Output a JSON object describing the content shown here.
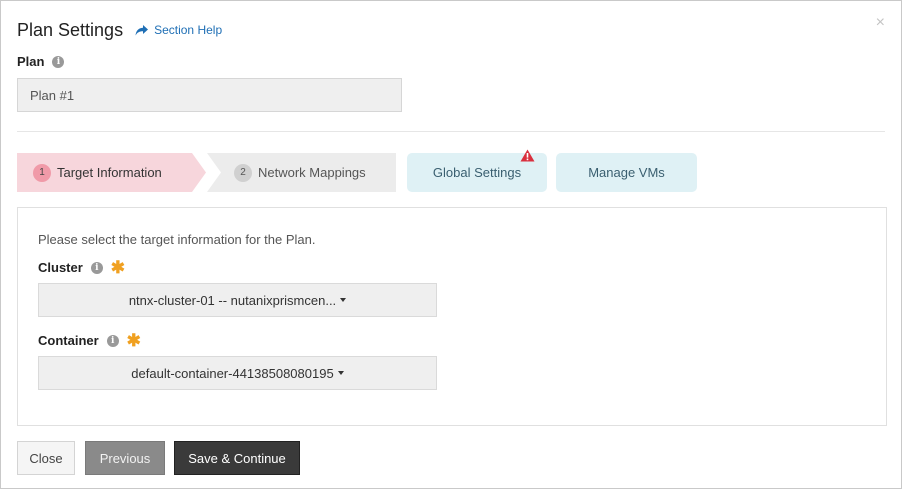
{
  "dialog": {
    "title": "Plan Settings",
    "help_link": "Section Help",
    "close_glyph": "×"
  },
  "plan": {
    "label": "Plan",
    "value": "Plan #1"
  },
  "steps": [
    {
      "number": "1",
      "label": "Target Information",
      "state": "active"
    },
    {
      "number": "2",
      "label": "Network Mappings",
      "state": "inactive"
    }
  ],
  "tabs": [
    {
      "label": "Global Settings",
      "warning": true
    },
    {
      "label": "Manage VMs",
      "warning": false
    }
  ],
  "panel": {
    "description": "Please select the target information for the Plan.",
    "cluster": {
      "label": "Cluster",
      "required": true,
      "selected": "ntnx-cluster-01 -- nutanixprismcen..."
    },
    "container": {
      "label": "Container",
      "required": true,
      "selected": "default-container-44138508080195"
    }
  },
  "buttons": {
    "close": "Close",
    "previous": "Previous",
    "save": "Save & Continue"
  },
  "icons": {
    "info": "info-icon",
    "required": "asterisk-icon",
    "warning": "warning-triangle-icon",
    "help": "share-arrow-icon"
  },
  "colors": {
    "active_step": "#f7d6dc",
    "inactive_step": "#ececec",
    "tab_bg": "#dff1f5",
    "warning": "#d9303e",
    "required": "#f0a020",
    "link": "#1f6fb5",
    "primary_button": "#3a3a3a"
  }
}
